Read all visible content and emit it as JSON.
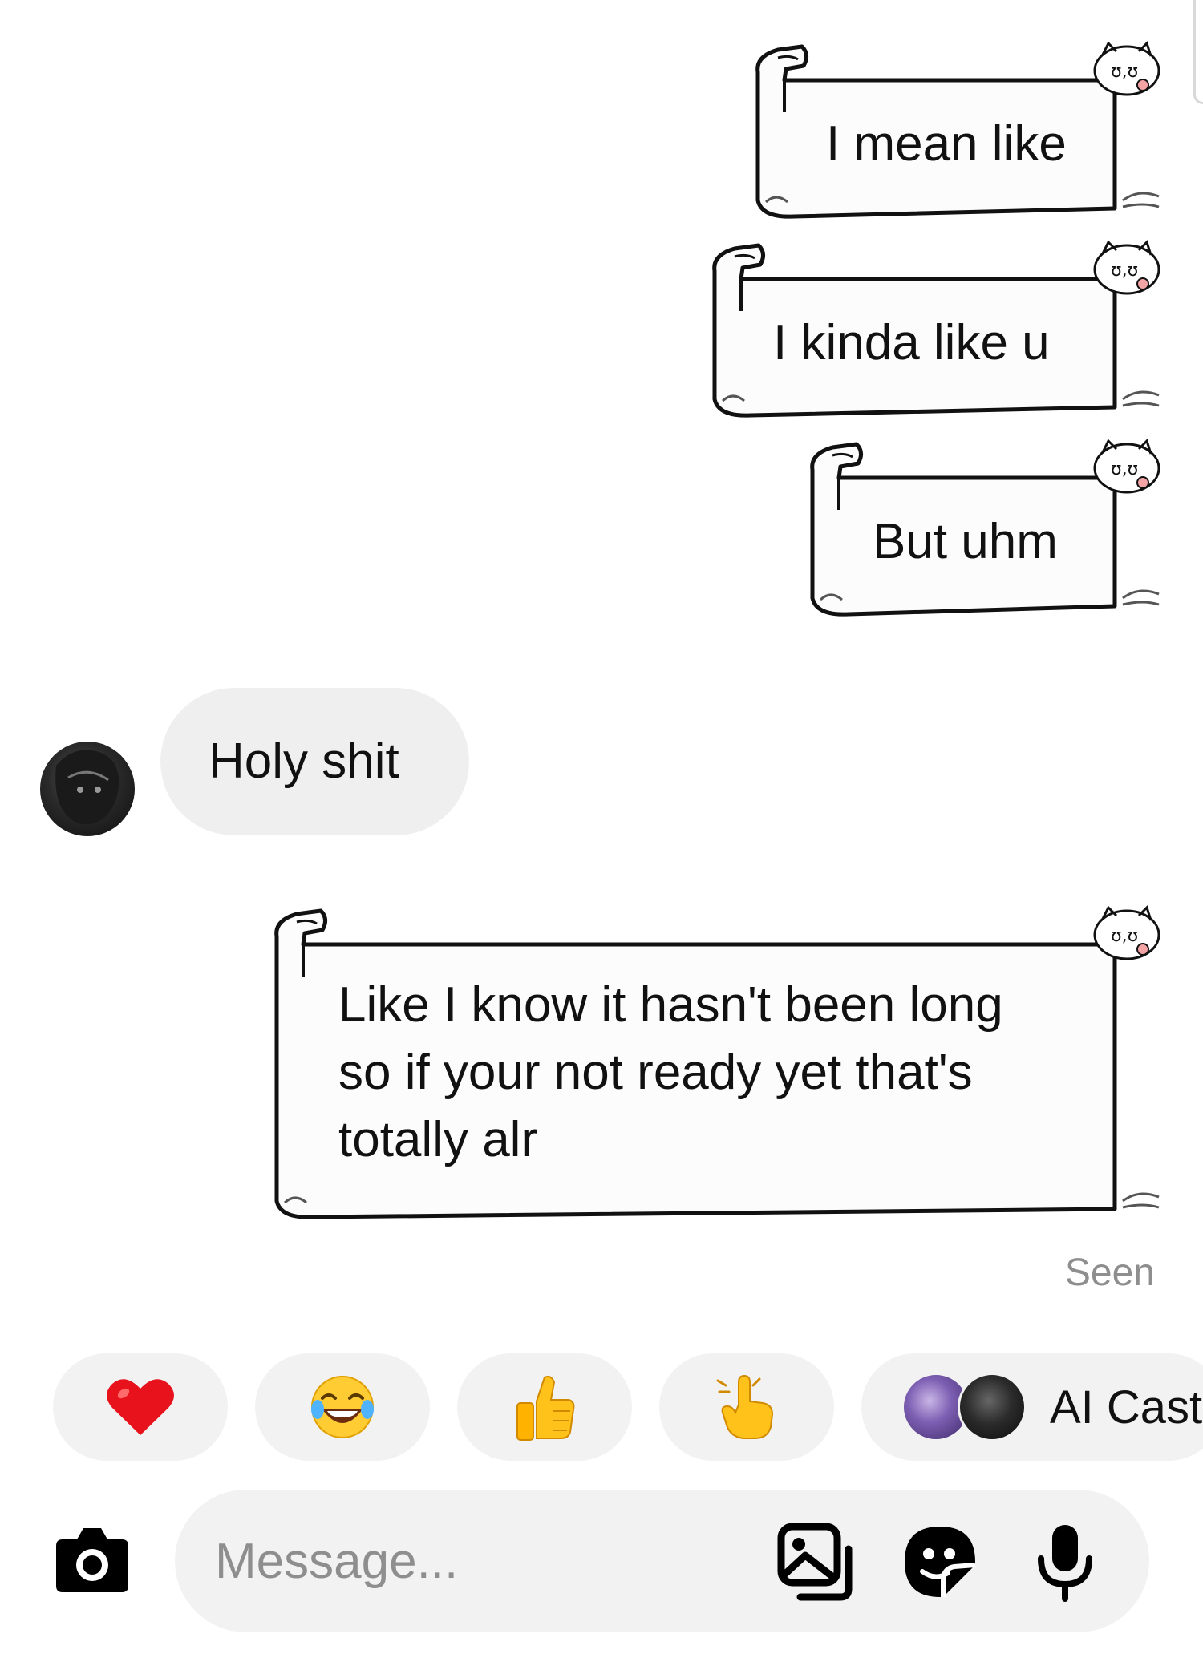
{
  "messages": {
    "sent_1": "I mean like",
    "sent_2": "I kinda like u",
    "sent_3": "But uhm",
    "received_1": "Holy shit",
    "sent_4": "Like I know it hasn't been long\nso if your not ready yet that's\ntotally alr"
  },
  "status": {
    "seen": "Seen"
  },
  "quick_reactions": {
    "items": [
      {
        "emoji": "❤️",
        "icon": "red-heart-icon"
      },
      {
        "emoji": "😂",
        "icon": "laughing-crying-face-icon"
      },
      {
        "emoji": "👍",
        "icon": "thumbs-up-icon"
      },
      {
        "emoji": "👆",
        "icon": "pointing-up-hand-icon"
      }
    ],
    "ai_label": "AI Cast"
  },
  "composer": {
    "placeholder": "Message...",
    "icons": [
      "camera-icon",
      "gallery-icon",
      "sticker-icon",
      "microphone-icon"
    ]
  },
  "colors": {
    "background": "#ffffff",
    "bubble_received": "#efefef",
    "reaction_pill": "#f2f2f2",
    "muted_text": "#8e8e8e",
    "text": "#111111"
  }
}
